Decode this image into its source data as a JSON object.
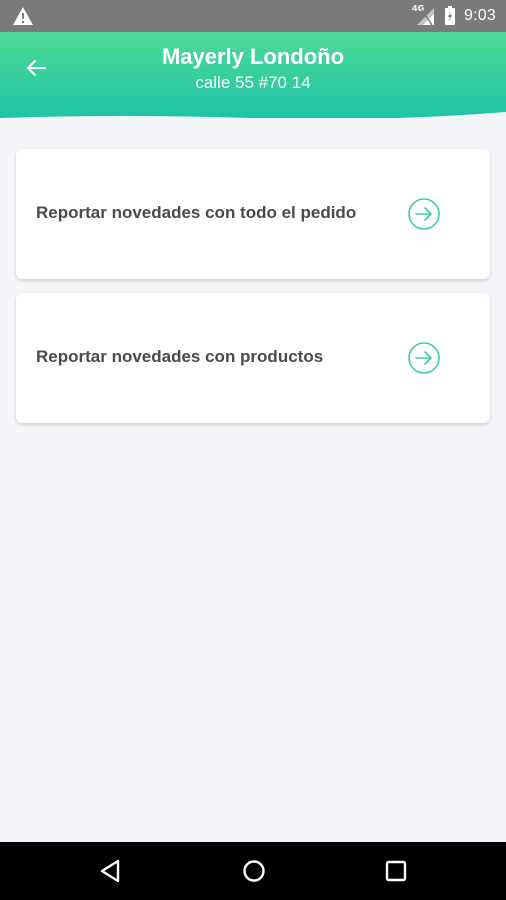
{
  "status_bar": {
    "time": "9:03",
    "network_label": "4G",
    "icons": [
      "warning-icon",
      "signal-icon",
      "battery-icon"
    ]
  },
  "header": {
    "title": "Mayerly Londoño",
    "subtitle": "calle 55 #70 14",
    "back_icon": "arrow-left-icon",
    "gradient": [
      "#4fd99a",
      "#1fc4a3"
    ]
  },
  "options": [
    {
      "label": "Reportar novedades con todo el pedido",
      "icon": "arrow-right-circle-icon"
    },
    {
      "label": "Reportar novedades con productos",
      "icon": "arrow-right-circle-icon"
    }
  ],
  "nav_bar": {
    "icons": [
      "nav-back-icon",
      "nav-home-icon",
      "nav-recent-apps-icon"
    ]
  },
  "colors": {
    "accent": "#2ecc9a",
    "background": "#f4f5f9",
    "card_text": "#4a4a4a",
    "status_bar": "#7a7a7a"
  }
}
